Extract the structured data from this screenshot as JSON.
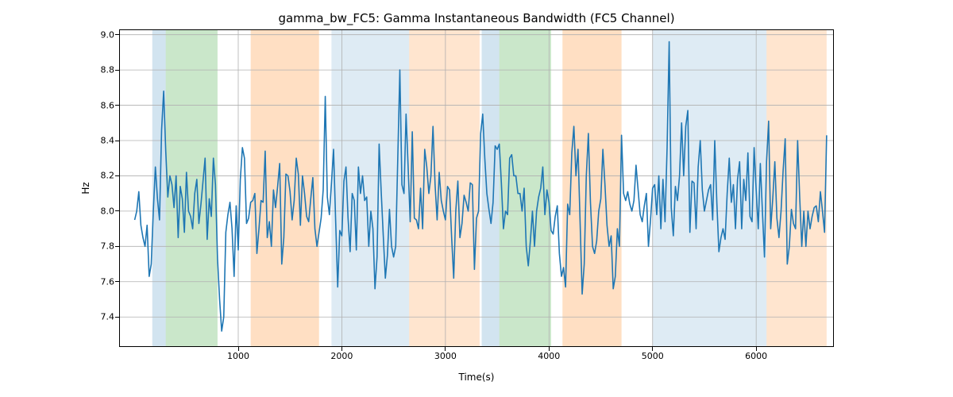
{
  "chart_data": {
    "type": "line",
    "title": "gamma_bw_FC5: Gamma Instantaneous Bandwidth (FC5 Channel)",
    "xlabel": "Time(s)",
    "ylabel": "Hz",
    "xlim": [
      -150,
      6750
    ],
    "ylim": [
      7.23,
      9.03
    ],
    "xticks": [
      1000,
      2000,
      3000,
      4000,
      5000,
      6000
    ],
    "yticks": [
      7.4,
      7.6,
      7.8,
      8.0,
      8.2,
      8.4,
      8.6,
      8.8,
      9.0
    ],
    "line_color": "#1f77b4",
    "grid_color": "#b0b0b0",
    "bands": [
      {
        "x0": 170,
        "x1": 300,
        "color": "#1f77b4",
        "alpha": 0.2
      },
      {
        "x0": 300,
        "x1": 800,
        "color": "#2ca02c",
        "alpha": 0.25
      },
      {
        "x0": 1120,
        "x1": 1780,
        "color": "#ff7f0e",
        "alpha": 0.25
      },
      {
        "x0": 1900,
        "x1": 2000,
        "color": "#1f77b4",
        "alpha": 0.15
      },
      {
        "x0": 2000,
        "x1": 2650,
        "color": "#1f77b4",
        "alpha": 0.15
      },
      {
        "x0": 2650,
        "x1": 3330,
        "color": "#ff7f0e",
        "alpha": 0.2
      },
      {
        "x0": 3350,
        "x1": 3520,
        "color": "#1f77b4",
        "alpha": 0.2
      },
      {
        "x0": 3520,
        "x1": 4020,
        "color": "#2ca02c",
        "alpha": 0.25
      },
      {
        "x0": 4130,
        "x1": 4700,
        "color": "#ff7f0e",
        "alpha": 0.25
      },
      {
        "x0": 5000,
        "x1": 6100,
        "color": "#1f77b4",
        "alpha": 0.15
      },
      {
        "x0": 6100,
        "x1": 6680,
        "color": "#ff7f0e",
        "alpha": 0.2
      }
    ],
    "series": [
      {
        "name": "gamma_bw_FC5",
        "x_step": 20,
        "x_start": 0,
        "values": [
          7.95,
          8.0,
          8.11,
          7.92,
          7.85,
          7.8,
          7.92,
          7.63,
          7.7,
          8.0,
          8.25,
          8.07,
          7.95,
          8.46,
          8.68,
          8.34,
          8.08,
          8.2,
          8.15,
          8.02,
          8.2,
          7.85,
          8.14,
          8.07,
          7.88,
          8.22,
          8.0,
          7.97,
          7.9,
          8.1,
          8.18,
          7.93,
          8.04,
          8.17,
          8.3,
          7.84,
          8.07,
          7.97,
          8.3,
          8.15,
          7.73,
          7.5,
          7.32,
          7.4,
          7.88,
          7.98,
          8.05,
          7.9,
          7.63,
          8.03,
          7.78,
          8.18,
          8.36,
          8.3,
          7.93,
          7.96,
          8.05,
          8.06,
          8.1,
          7.76,
          7.9,
          8.06,
          8.05,
          8.34,
          7.85,
          7.94,
          7.8,
          8.12,
          8.02,
          8.14,
          8.27,
          7.7,
          7.85,
          8.21,
          8.2,
          8.11,
          7.95,
          8.06,
          8.3,
          8.21,
          7.92,
          8.2,
          8.1,
          7.97,
          7.94,
          8.07,
          8.19,
          7.9,
          7.8,
          7.88,
          7.96,
          8.12,
          8.65,
          8.08,
          7.98,
          8.16,
          8.35,
          7.95,
          7.57,
          7.89,
          7.86,
          8.17,
          8.25,
          7.96,
          7.77,
          8.1,
          8.06,
          7.78,
          8.25,
          8.1,
          8.2,
          8.06,
          8.08,
          7.8,
          8.0,
          7.9,
          7.56,
          7.74,
          8.38,
          8.11,
          7.86,
          7.62,
          7.75,
          8.01,
          7.8,
          7.74,
          7.8,
          8.3,
          8.8,
          8.15,
          8.1,
          8.55,
          8.25,
          7.94,
          8.45,
          7.96,
          7.95,
          7.9,
          8.13,
          7.9,
          8.35,
          8.25,
          8.1,
          8.2,
          8.48,
          8.15,
          7.95,
          8.22,
          8.06,
          8.0,
          7.95,
          8.14,
          8.12,
          7.85,
          7.62,
          8.0,
          8.17,
          7.85,
          7.93,
          8.09,
          8.05,
          8.0,
          8.16,
          8.15,
          7.67,
          7.96,
          8.0,
          8.44,
          8.55,
          8.3,
          8.1,
          8.01,
          7.93,
          8.05,
          8.37,
          8.35,
          8.38,
          8.16,
          7.9,
          8.0,
          7.98,
          8.3,
          8.32,
          8.2,
          8.2,
          8.1,
          8.1,
          8.0,
          8.13,
          7.8,
          7.69,
          7.83,
          8.0,
          7.8,
          8.0,
          8.08,
          8.13,
          8.25,
          7.98,
          8.12,
          8.05,
          7.89,
          7.87,
          7.97,
          8.03,
          7.76,
          7.63,
          7.68,
          7.57,
          8.04,
          7.98,
          8.33,
          8.48,
          8.2,
          8.35,
          7.94,
          7.53,
          7.7,
          8.2,
          8.44,
          8.05,
          7.8,
          7.76,
          7.83,
          8.0,
          8.07,
          8.35,
          8.15,
          7.92,
          7.8,
          7.86,
          7.56,
          7.63,
          7.9,
          7.8,
          8.43,
          8.1,
          8.06,
          8.11,
          8.04,
          8.0,
          8.06,
          8.26,
          8.12,
          7.98,
          7.94,
          8.03,
          8.1,
          7.8,
          7.95,
          8.13,
          8.15,
          7.98,
          8.2,
          7.9,
          8.18,
          7.94,
          8.36,
          8.96,
          8.02,
          7.86,
          8.14,
          8.06,
          8.2,
          8.5,
          8.2,
          8.48,
          8.57,
          7.88,
          8.17,
          8.16,
          7.9,
          8.25,
          8.4,
          8.12,
          8.0,
          8.06,
          8.12,
          8.15,
          7.95,
          8.4,
          8.05,
          7.77,
          7.85,
          7.9,
          7.84,
          8.1,
          8.3,
          8.05,
          8.15,
          7.9,
          8.18,
          8.28,
          7.9,
          8.18,
          8.06,
          8.33,
          7.97,
          7.94,
          8.36,
          8.12,
          7.9,
          8.27,
          8.0,
          7.74,
          8.28,
          8.51,
          7.9,
          8.07,
          8.28,
          7.96,
          7.85,
          8.0,
          8.23,
          8.41,
          7.7,
          7.8,
          8.01,
          7.93,
          7.9,
          8.4,
          8.08,
          7.8,
          8.0,
          7.8,
          8.0,
          7.9,
          7.97,
          8.02,
          8.03,
          7.94,
          8.11,
          8.0,
          7.88,
          8.43
        ]
      }
    ]
  }
}
